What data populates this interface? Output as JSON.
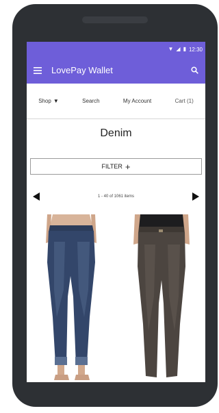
{
  "status_bar": {
    "time": "12:30",
    "wifi_icon": "wifi-icon",
    "signal_icon": "signal-icon",
    "battery_icon": "battery-icon"
  },
  "app_bar": {
    "title": "LovePay Wallet",
    "menu_icon": "menu-icon",
    "search_icon": "search-icon",
    "color": "#6e5ed9"
  },
  "nav": {
    "shop_label": "Shop",
    "search_label": "Search",
    "account_label": "My Account",
    "cart_label": "Cart (1)"
  },
  "page": {
    "title": "Denim",
    "filter_label": "FILTER",
    "results_text": "1 - 40 of 1061 items"
  },
  "products": [
    {
      "image": "blue-jeans",
      "color": "#2f4060"
    },
    {
      "image": "brown-jeans",
      "color": "#4a4440"
    }
  ]
}
